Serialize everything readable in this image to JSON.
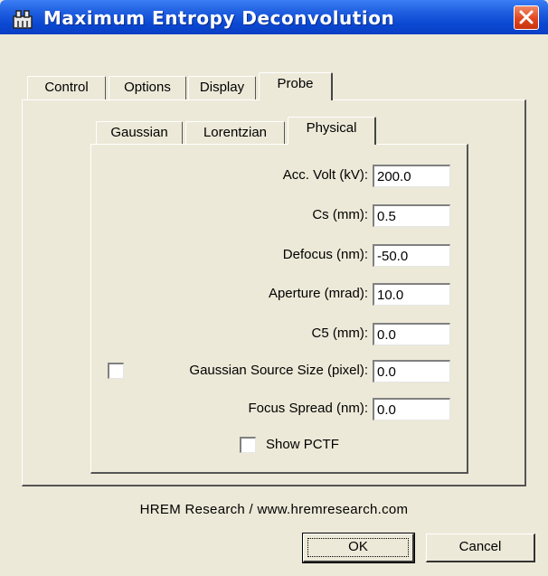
{
  "window": {
    "title": "Maximum Entropy Deconvolution",
    "icons": {
      "app": "dialog-app-icon",
      "close": "close-x-icon"
    }
  },
  "main_tabs": [
    "Control",
    "Options",
    "Display",
    "Probe"
  ],
  "active_main_tab": "Probe",
  "probe_tabs": [
    "Gaussian",
    "Lorentzian",
    "Physical"
  ],
  "active_probe_tab": "Physical",
  "fields": {
    "acc_volt": {
      "label": "Acc. Volt (kV):",
      "value": "200.0"
    },
    "cs": {
      "label": "Cs (mm):",
      "value": "0.5"
    },
    "defocus": {
      "label": "Defocus (nm):",
      "value": "-50.0"
    },
    "aperture": {
      "label": "Aperture (mrad):",
      "value": "10.0"
    },
    "c5": {
      "label": "C5 (mm):",
      "value": "0.0"
    },
    "gaussian_source_size": {
      "label": "Gaussian Source Size (pixel):",
      "value": "0.0",
      "checked": false
    },
    "focus_spread": {
      "label": "Focus Spread (nm):",
      "value": "0.0"
    }
  },
  "show_pctf": {
    "label": "Show PCTF",
    "checked": false
  },
  "footer": {
    "credit": "HREM Research / www.hremresearch.com"
  },
  "buttons": {
    "ok": "OK",
    "cancel": "Cancel"
  },
  "colors": {
    "title_bar": "#0a48d2",
    "close_button": "#e0461e",
    "dialog_bg": "#ece9d8"
  }
}
